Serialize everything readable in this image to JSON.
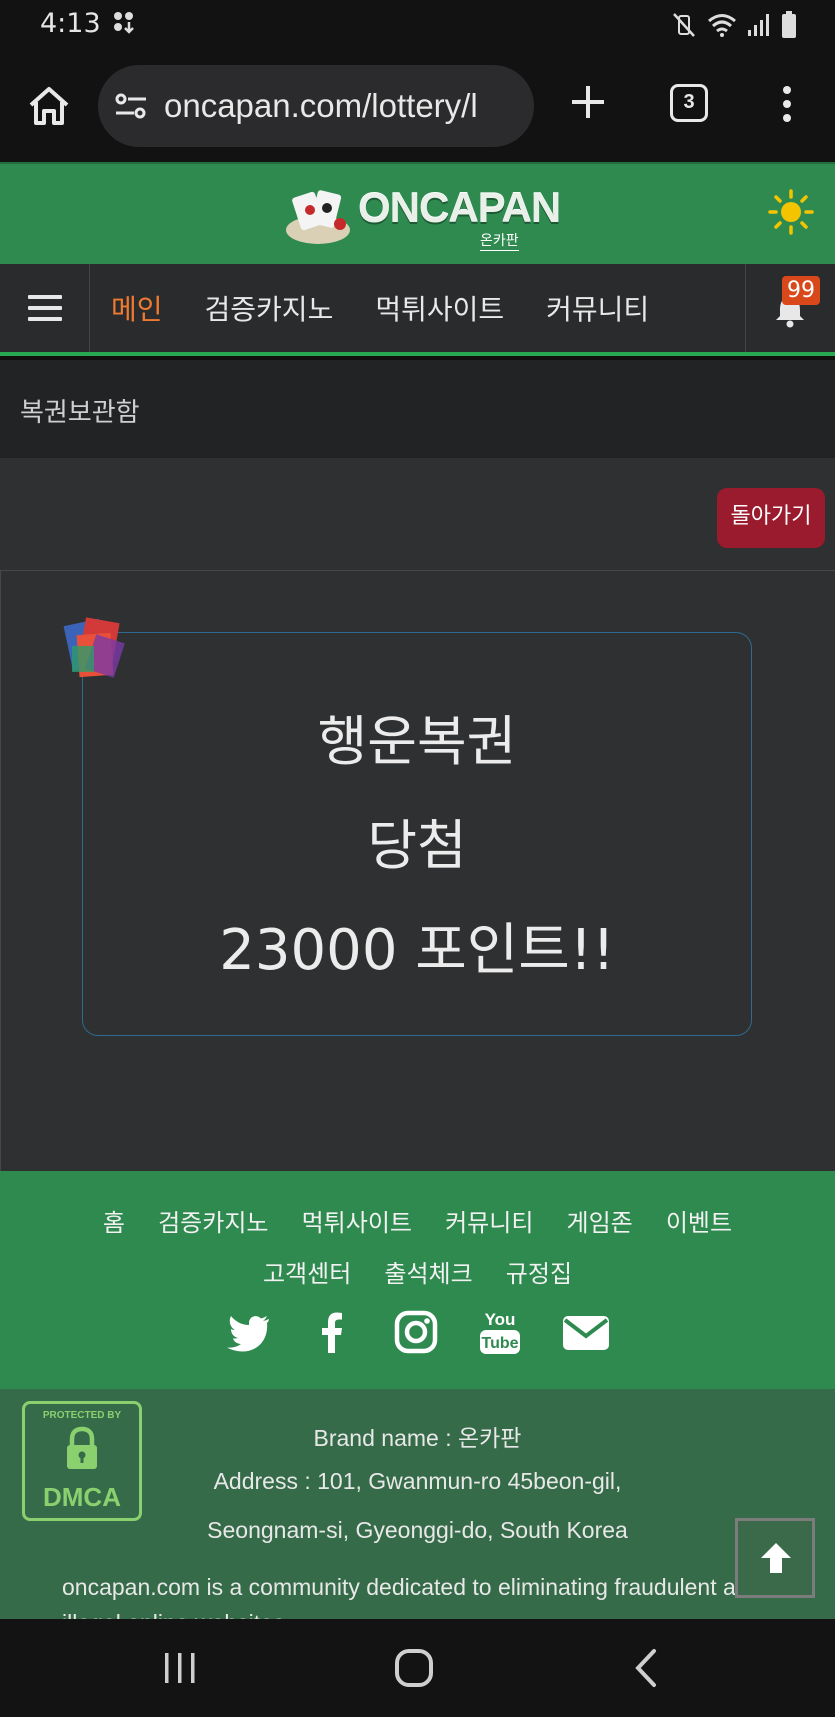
{
  "status_bar": {
    "time": "4:13"
  },
  "browser": {
    "url": "oncapan.com/lottery/l",
    "tab_count": "3"
  },
  "site": {
    "logo_text": "ONCAPAN",
    "logo_sub": "온카판"
  },
  "nav": {
    "items": [
      "메인",
      "검증카지노",
      "먹튀사이트",
      "커뮤니티"
    ],
    "notification_count": "99"
  },
  "breadcrumb": {
    "title": "복권보관함"
  },
  "content": {
    "back_label": "돌아가기",
    "result": {
      "title": "행운복권",
      "sub": "당첨",
      "amount": "23000 포인트!!"
    }
  },
  "footer": {
    "links_row1": [
      "홈",
      "검증카지노",
      "먹튀사이트",
      "커뮤니티",
      "게임존",
      "이벤트"
    ],
    "links_row2": [
      "고객센터",
      "출석체크",
      "규정집"
    ],
    "social_icons": [
      "twitter-icon",
      "facebook-icon",
      "instagram-icon",
      "youtube-icon",
      "mail-icon"
    ]
  },
  "info": {
    "brand": "Brand name : 온카판",
    "address1": "Address : 101, Gwanmun-ro 45beon-gil,",
    "address2": "Seongnam-si, Gyeonggi-do, South Korea",
    "desc": "oncapan.com is a community dedicated to eliminating fraudulent and illegal online websites.",
    "dmca_top": "PROTECTED BY",
    "dmca_bottom": "DMCA"
  },
  "colors": {
    "brand_green": "#2e8a4f",
    "nav_active": "#f07a30",
    "back_button": "#9a1b2d",
    "badge": "#d9481a"
  }
}
